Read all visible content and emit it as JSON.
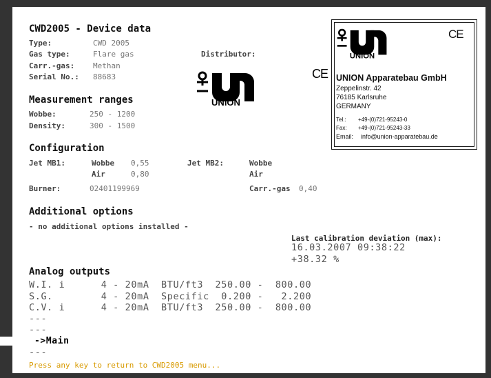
{
  "header": {
    "title": "CWD2005 - Device data"
  },
  "device": {
    "type_label": "Type:",
    "type_value": "CWD 2005",
    "gas_label": "Gas type:",
    "gas_value": "Flare gas",
    "carr_label": "Carr.-gas:",
    "carr_value": "Methan",
    "serial_label": "Serial No.:",
    "serial_value": "88683",
    "distributor_label": "Distributor:"
  },
  "ranges": {
    "heading": "Measurement ranges",
    "wobbe_label": "Wobbe:",
    "wobbe_value": "250 - 1200",
    "density_label": "Density:",
    "density_value": "300 - 1500"
  },
  "config": {
    "heading": "Configuration",
    "jet1_label": "Jet MB1:",
    "jet1_wobbe_label": "Wobbe",
    "jet1_wobbe_value": "0,55",
    "jet1_air_label": "Air",
    "jet1_air_value": "0,80",
    "jet2_label": "Jet MB2:",
    "jet2_wobbe_label": "Wobbe",
    "jet2_air_label": "Air",
    "burner_label": "Burner:",
    "burner_value": "02401199969",
    "carr_label": "Carr.-gas",
    "carr_value": "0,40"
  },
  "options": {
    "heading": "Additional options",
    "text": "- no additional options installed -"
  },
  "calibration": {
    "label": "Last calibration deviation (max):",
    "datetime": "16.03.2007 09:38:22",
    "value": "+38.32 %"
  },
  "analog": {
    "heading": "Analog outputs",
    "rows": [
      "W.I. i      4 - 20mA  BTU/ft3  250.00 -  800.00",
      "S.G.        4 - 20mA  Specific  0.200 -   2.200",
      "C.V. i      4 - 20mA  BTU/ft3  250.00 -  800.00",
      "---",
      "---"
    ],
    "main_link": "->Main",
    "after_main": "---"
  },
  "footer": {
    "prompt": "Press any key to return to CWD2005 menu..."
  },
  "card": {
    "ce": "CE",
    "company": "UNION Apparatebau GmbH",
    "street": "Zeppelinstr. 42",
    "city": "76185 Karlsruhe",
    "country": "GERMANY",
    "tel_label": "Tel.:",
    "tel_value": "+49-(0)721-95243-0",
    "fax_label": "Fax:",
    "fax_value": "+49-(0)721-95243-33",
    "email_label": "Email:",
    "email_value": "info@union-apparatebau.de"
  },
  "logo": {
    "ce": "CE"
  }
}
